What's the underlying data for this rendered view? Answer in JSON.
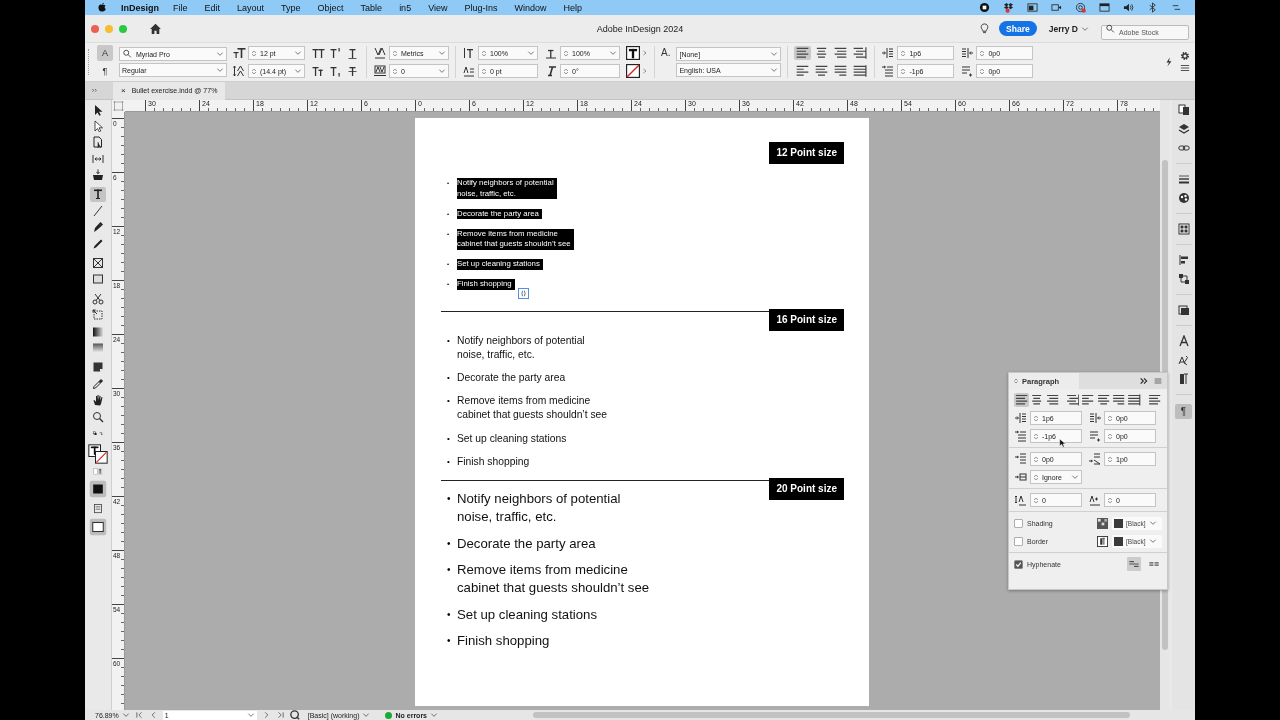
{
  "menu_bar": {
    "app_name": "InDesign",
    "items": [
      "File",
      "Edit",
      "Layout",
      "Type",
      "Object",
      "Table",
      "in5",
      "View",
      "Plug-Ins",
      "Window",
      "Help"
    ]
  },
  "window": {
    "title": "Adobe InDesign 2024"
  },
  "header": {
    "share_button": "Share",
    "user": "Jerry D",
    "search": {
      "placeholder": "Adobe Stock"
    }
  },
  "control_panel": {
    "modes": [
      {
        "label": "A",
        "selected": true
      },
      {
        "label": "¶",
        "selected": false
      }
    ],
    "font_family": "Myriad Pro",
    "font_style": "Regular",
    "font_size": "12 pt",
    "leading": "(14.4 pt)",
    "kerning": "Metrics",
    "tracking": "0",
    "vertical_scale": "100%",
    "horizontal_scale": "100%",
    "baseline_shift": "0 pt",
    "skew": "0°",
    "character_style_label": "A.",
    "character_style": "[None]",
    "language": "English: USA",
    "alignment": [
      {
        "selected": true
      },
      {
        "selected": false
      },
      {
        "selected": false
      },
      {
        "selected": false
      },
      {
        "selected": false
      },
      {
        "selected": false
      },
      {
        "selected": false
      },
      {
        "selected": false
      }
    ],
    "left_indent": "1p6",
    "first_line_indent": "-1p6",
    "right_indent": "0p0",
    "last_line_indent": "0p0"
  },
  "document_tab": {
    "close": "×",
    "title": "Bullet exercise.indd @ 77%"
  },
  "tools": [
    {
      "selected": false
    },
    {
      "selected": false
    },
    {
      "selected": false
    },
    {
      "selected": false
    },
    {
      "selected": false
    },
    {
      "selected": true
    },
    {
      "selected": false
    },
    {
      "selected": false
    },
    {
      "selected": false
    },
    {
      "selected": false
    },
    {
      "selected": false
    },
    {
      "selected": false
    },
    {
      "selected": false
    },
    {
      "selected": false
    },
    {
      "selected": false
    },
    {
      "selected": false
    },
    {
      "selected": false
    },
    {
      "selected": false
    },
    {
      "selected": false
    }
  ],
  "rulers": {
    "horizontal": [
      "30",
      "24",
      "18",
      "12",
      "6",
      "0",
      "6",
      "12",
      "18",
      "24",
      "30",
      "36",
      "42",
      "48",
      "54",
      "60",
      "66",
      "72",
      "78"
    ],
    "vertical": [
      "0",
      "6",
      "12",
      "18",
      "24",
      "30",
      "36",
      "42",
      "48",
      "54",
      "60"
    ]
  },
  "page": {
    "sections": [
      {
        "kind": "small",
        "divider": false,
        "highlighted": true,
        "heading": "12 Point size",
        "items": [
          {
            "bullet": "•",
            "lines": [
              "Notify neighbors of potential",
              "noise, traffic, etc."
            ]
          },
          {
            "bullet": "•",
            "lines": [
              "Decorate the party area"
            ]
          },
          {
            "bullet": "•",
            "lines": [
              "Remove items from medicine",
              "cabinet that guests shouldn’t see"
            ]
          },
          {
            "bullet": "•",
            "lines": [
              "Set up cleaning stations"
            ]
          },
          {
            "bullet": "•",
            "lines": [
              "Finish shopping"
            ]
          }
        ]
      },
      {
        "kind": "medium",
        "divider": true,
        "highlighted": false,
        "heading": "16 Point size",
        "items": [
          {
            "bullet": "•",
            "lines": [
              "Notify neighbors of potential",
              "noise, traffic, etc."
            ]
          },
          {
            "bullet": "•",
            "lines": [
              "Decorate the party area"
            ]
          },
          {
            "bullet": "•",
            "lines": [
              "Remove items from medicine",
              "cabinet that guests shouldn’t see"
            ]
          },
          {
            "bullet": "•",
            "lines": [
              "Set up cleaning stations"
            ]
          },
          {
            "bullet": "•",
            "lines": [
              "Finish shopping"
            ]
          }
        ]
      },
      {
        "kind": "large",
        "divider": true,
        "highlighted": false,
        "heading": "20 Point size",
        "items": [
          {
            "bullet": "•",
            "lines": [
              "Notify neighbors of potential",
              "noise, traffic, etc."
            ]
          },
          {
            "bullet": "•",
            "lines": [
              "Decorate the party area"
            ]
          },
          {
            "bullet": "•",
            "lines": [
              "Remove items from medicine",
              "cabinet that guests shouldn’t see"
            ]
          },
          {
            "bullet": "•",
            "lines": [
              "Set up cleaning stations"
            ]
          },
          {
            "bullet": "•",
            "lines": [
              "Finish shopping"
            ]
          }
        ]
      }
    ]
  },
  "paragraph_panel": {
    "title": "Paragraph",
    "alignment": [
      {
        "selected": true
      },
      {
        "selected": false
      },
      {
        "selected": false
      },
      {
        "selected": false
      },
      {
        "selected": false
      },
      {
        "selected": false
      },
      {
        "selected": false
      },
      {
        "selected": false
      },
      {
        "selected": false
      }
    ],
    "left_indent": "1p6",
    "right_indent": "0p0",
    "first_line_indent": "-1p6",
    "last_line_indent": "0p0",
    "space_before": "0p0",
    "space_after": "1p0",
    "align_to_grid": "Ignore",
    "drop_cap_lines": "0",
    "drop_cap_characters": "0",
    "shading": {
      "label": "Shading",
      "checked": false,
      "swatch": "[Black]"
    },
    "border": {
      "label": "Border",
      "checked": false,
      "swatch": "[Black]"
    },
    "hyphenate": {
      "label": "Hyphenate",
      "checked": true
    }
  },
  "dock": {
    "paragraph_button": {
      "label": "¶",
      "selected": true
    }
  },
  "status_bar": {
    "zoom": "76.89%",
    "page": "1",
    "profile": "[Basic] (working)",
    "preflight": "No errors"
  }
}
